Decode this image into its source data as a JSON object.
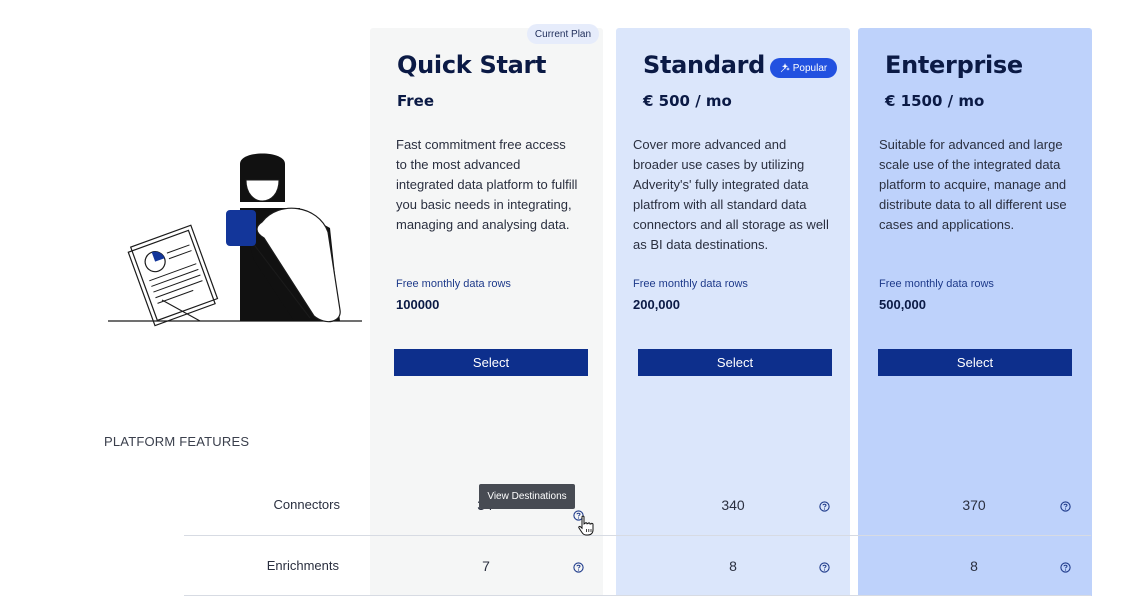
{
  "plans": {
    "quick": {
      "badge": "Current Plan",
      "title": "Quick Start",
      "price": "Free",
      "description": "Fast commitment free access to the most advanced integrated data platform to fulfill you basic needs in integrating, managing and analysing data.",
      "rows_label": "Free monthly data rows",
      "rows_value": "100000",
      "select_label": "Select"
    },
    "standard": {
      "badge": "Popular",
      "title": "Standard",
      "price": "€ 500 / mo",
      "description": "Cover more advanced and broader use cases by utilizing Adverity's' fully integrated data platfrom with all standard data connectors and all storage as well as BI data destinations.",
      "rows_label": "Free monthly data rows",
      "rows_value": "200,000",
      "select_label": "Select"
    },
    "enterprise": {
      "title": "Enterprise",
      "price": "€ 1500 / mo",
      "description": "Suitable for advanced and large scale use of the integrated data platform to acquire, manage and distribute data to all different use cases and applications.",
      "rows_label": "Free monthly data rows",
      "rows_value": "500,000",
      "select_label": "Select"
    }
  },
  "features": {
    "section_label": "PLATFORM FEATURES",
    "rows": [
      {
        "label": "Connectors",
        "quick": "34",
        "standard": "340",
        "enterprise": "370"
      },
      {
        "label": "Enrichments",
        "quick": "7",
        "standard": "8",
        "enterprise": "8"
      }
    ]
  },
  "tooltip": "View Destinations",
  "colors": {
    "accent": "#0d2f8c",
    "popular_badge": "#2251e0",
    "quick_bg": "#f5f6f6",
    "standard_bg": "#dbe6fb",
    "enterprise_bg": "#bed2fb"
  },
  "icons": [
    "help-circle-icon",
    "sparkle-icon",
    "pointer-hand-icon"
  ]
}
